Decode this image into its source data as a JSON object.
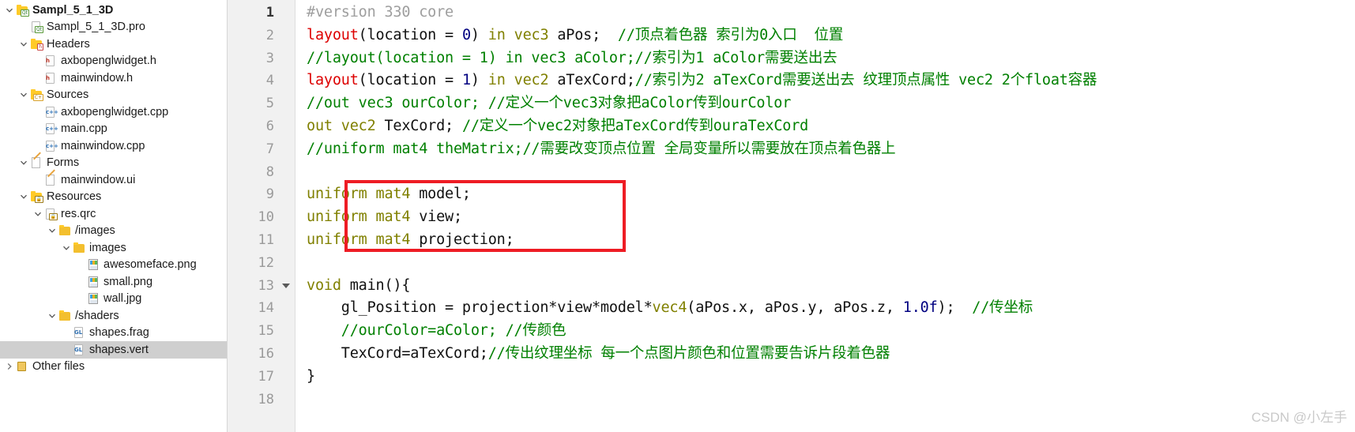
{
  "sidebar": {
    "name": "project-tree",
    "items": [
      {
        "label": "Sampl_5_1_3D",
        "indent": 0,
        "twisty": "down",
        "icon": "qt-project-icon",
        "bold": true,
        "selected": false
      },
      {
        "label": "Sampl_5_1_3D.pro",
        "indent": 1,
        "twisty": "none",
        "icon": "pro-file-icon",
        "bold": false,
        "selected": false
      },
      {
        "label": "Headers",
        "indent": 1,
        "twisty": "down",
        "icon": "folder-h-icon",
        "bold": false,
        "selected": false
      },
      {
        "label": "axbopenglwidget.h",
        "indent": 2,
        "twisty": "none",
        "icon": "header-file-icon",
        "bold": false,
        "selected": false
      },
      {
        "label": "mainwindow.h",
        "indent": 2,
        "twisty": "none",
        "icon": "header-file-icon",
        "bold": false,
        "selected": false
      },
      {
        "label": "Sources",
        "indent": 1,
        "twisty": "down",
        "icon": "folder-cpp-icon",
        "bold": false,
        "selected": false
      },
      {
        "label": "axbopenglwidget.cpp",
        "indent": 2,
        "twisty": "none",
        "icon": "cpp-file-icon",
        "bold": false,
        "selected": false
      },
      {
        "label": "main.cpp",
        "indent": 2,
        "twisty": "none",
        "icon": "cpp-file-icon",
        "bold": false,
        "selected": false
      },
      {
        "label": "mainwindow.cpp",
        "indent": 2,
        "twisty": "none",
        "icon": "cpp-file-icon",
        "bold": false,
        "selected": false
      },
      {
        "label": "Forms",
        "indent": 1,
        "twisty": "down",
        "icon": "folder-form-icon",
        "bold": false,
        "selected": false
      },
      {
        "label": "mainwindow.ui",
        "indent": 2,
        "twisty": "none",
        "icon": "ui-file-icon",
        "bold": false,
        "selected": false
      },
      {
        "label": "Resources",
        "indent": 1,
        "twisty": "down",
        "icon": "folder-res-icon",
        "bold": false,
        "selected": false
      },
      {
        "label": "res.qrc",
        "indent": 2,
        "twisty": "down",
        "icon": "qrc-file-icon",
        "bold": false,
        "selected": false
      },
      {
        "label": "/images",
        "indent": 3,
        "twisty": "down",
        "icon": "folder-icon",
        "bold": false,
        "selected": false
      },
      {
        "label": "images",
        "indent": 4,
        "twisty": "down",
        "icon": "folder-icon",
        "bold": false,
        "selected": false
      },
      {
        "label": "awesomeface.png",
        "indent": 5,
        "twisty": "none",
        "icon": "image-file-icon",
        "bold": false,
        "selected": false
      },
      {
        "label": "small.png",
        "indent": 5,
        "twisty": "none",
        "icon": "image-file-icon",
        "bold": false,
        "selected": false
      },
      {
        "label": "wall.jpg",
        "indent": 5,
        "twisty": "none",
        "icon": "image-file-icon",
        "bold": false,
        "selected": false
      },
      {
        "label": "/shaders",
        "indent": 3,
        "twisty": "down",
        "icon": "folder-icon",
        "bold": false,
        "selected": false
      },
      {
        "label": "shapes.frag",
        "indent": 4,
        "twisty": "none",
        "icon": "gl-file-icon",
        "bold": false,
        "selected": false
      },
      {
        "label": "shapes.vert",
        "indent": 4,
        "twisty": "none",
        "icon": "gl-file-icon",
        "bold": false,
        "selected": true
      },
      {
        "label": "Other files",
        "indent": 0,
        "twisty": "right",
        "icon": "other-files-icon",
        "bold": false,
        "selected": false
      }
    ]
  },
  "editor": {
    "name": "code-editor",
    "language": "glsl",
    "file": "shapes.vert",
    "gutter": {
      "numbers": [
        "1",
        "2",
        "3",
        "4",
        "5",
        "6",
        "7",
        "8",
        "9",
        "10",
        "11",
        "12",
        "13",
        "14",
        "15",
        "16",
        "17",
        "18"
      ],
      "current_line": "1",
      "fold_marker_line": "13"
    },
    "lines": [
      {
        "n": "1",
        "tokens": [
          {
            "t": "pre",
            "s": "#version 330 core"
          }
        ]
      },
      {
        "n": "2",
        "tokens": [
          {
            "t": "kw",
            "s": "layout"
          },
          {
            "t": "txt",
            "s": "("
          },
          {
            "t": "txt",
            "s": "location"
          },
          {
            "t": "txt",
            "s": " = "
          },
          {
            "t": "num",
            "s": "0"
          },
          {
            "t": "txt",
            "s": ") "
          },
          {
            "t": "type",
            "s": "in"
          },
          {
            "t": "txt",
            "s": " "
          },
          {
            "t": "type",
            "s": "vec3"
          },
          {
            "t": "txt",
            "s": " aPos;  "
          },
          {
            "t": "cmt",
            "s": "//顶点着色器 索引为0入口  位置"
          }
        ]
      },
      {
        "n": "3",
        "tokens": [
          {
            "t": "cmt",
            "s": "//layout(location = 1) in vec3 aColor;//索引为1 aColor需要送出去"
          }
        ]
      },
      {
        "n": "4",
        "tokens": [
          {
            "t": "kw",
            "s": "layout"
          },
          {
            "t": "txt",
            "s": "("
          },
          {
            "t": "txt",
            "s": "location"
          },
          {
            "t": "txt",
            "s": " = "
          },
          {
            "t": "num",
            "s": "1"
          },
          {
            "t": "txt",
            "s": ") "
          },
          {
            "t": "type",
            "s": "in"
          },
          {
            "t": "txt",
            "s": " "
          },
          {
            "t": "type",
            "s": "vec2"
          },
          {
            "t": "txt",
            "s": " aTexCord;"
          },
          {
            "t": "cmt",
            "s": "//索引为2 aTexCord需要送出去 纹理顶点属性 vec2 2个float容器"
          }
        ]
      },
      {
        "n": "5",
        "tokens": [
          {
            "t": "cmt",
            "s": "//out vec3 ourColor; //定义一个vec3对象把aColor传到ourColor"
          }
        ]
      },
      {
        "n": "6",
        "tokens": [
          {
            "t": "type",
            "s": "out"
          },
          {
            "t": "txt",
            "s": " "
          },
          {
            "t": "type",
            "s": "vec2"
          },
          {
            "t": "txt",
            "s": " TexCord; "
          },
          {
            "t": "cmt",
            "s": "//定义一个vec2对象把aTexCord传到ouraTexCord"
          }
        ]
      },
      {
        "n": "7",
        "tokens": [
          {
            "t": "cmt",
            "s": "//uniform mat4 theMatrix;//需要改变顶点位置 全局变量所以需要放在顶点着色器上"
          }
        ]
      },
      {
        "n": "8",
        "tokens": []
      },
      {
        "n": "9",
        "tokens": [
          {
            "t": "type",
            "s": "uniform"
          },
          {
            "t": "txt",
            "s": " "
          },
          {
            "t": "type",
            "s": "mat4"
          },
          {
            "t": "txt",
            "s": " model;"
          }
        ]
      },
      {
        "n": "10",
        "tokens": [
          {
            "t": "type",
            "s": "uniform"
          },
          {
            "t": "txt",
            "s": " "
          },
          {
            "t": "type",
            "s": "mat4"
          },
          {
            "t": "txt",
            "s": " view;"
          }
        ]
      },
      {
        "n": "11",
        "tokens": [
          {
            "t": "type",
            "s": "uniform"
          },
          {
            "t": "txt",
            "s": " "
          },
          {
            "t": "type",
            "s": "mat4"
          },
          {
            "t": "txt",
            "s": " projection;"
          }
        ]
      },
      {
        "n": "12",
        "tokens": []
      },
      {
        "n": "13",
        "tokens": [
          {
            "t": "type",
            "s": "void"
          },
          {
            "t": "txt",
            "s": " main(){"
          }
        ]
      },
      {
        "n": "14",
        "tokens": [
          {
            "t": "txt",
            "s": "    gl_Position = projection*view*model*"
          },
          {
            "t": "type",
            "s": "vec4"
          },
          {
            "t": "txt",
            "s": "(aPos.x, aPos.y, aPos.z, "
          },
          {
            "t": "num",
            "s": "1.0f"
          },
          {
            "t": "txt",
            "s": ");  "
          },
          {
            "t": "cmt",
            "s": "//传坐标"
          }
        ]
      },
      {
        "n": "15",
        "tokens": [
          {
            "t": "txt",
            "s": "    "
          },
          {
            "t": "cmt",
            "s": "//ourColor=aColor; //传颜色"
          }
        ]
      },
      {
        "n": "16",
        "tokens": [
          {
            "t": "txt",
            "s": "    TexCord=aTexCord;"
          },
          {
            "t": "cmt",
            "s": "//传出纹理坐标 每一个点图片颜色和位置需要告诉片段着色器"
          }
        ]
      },
      {
        "n": "17",
        "tokens": [
          {
            "t": "txt",
            "s": "}"
          }
        ]
      },
      {
        "n": "18",
        "tokens": []
      }
    ],
    "annotation": {
      "type": "rectangle-highlight",
      "color": "#ee1c24",
      "covers_lines": [
        "9",
        "10",
        "11"
      ]
    }
  },
  "watermark": {
    "text": "CSDN @小左手",
    "color": "#c9c9c9"
  },
  "colors": {
    "keyword": "#dd0000",
    "type": "#808000",
    "number": "#000080",
    "comment": "#008000",
    "preprocessor": "#9e9e9e",
    "gutter_bg": "#f1f1f1",
    "selection_bg": "#cfcfcf",
    "annotation_red": "#ee1c24"
  }
}
